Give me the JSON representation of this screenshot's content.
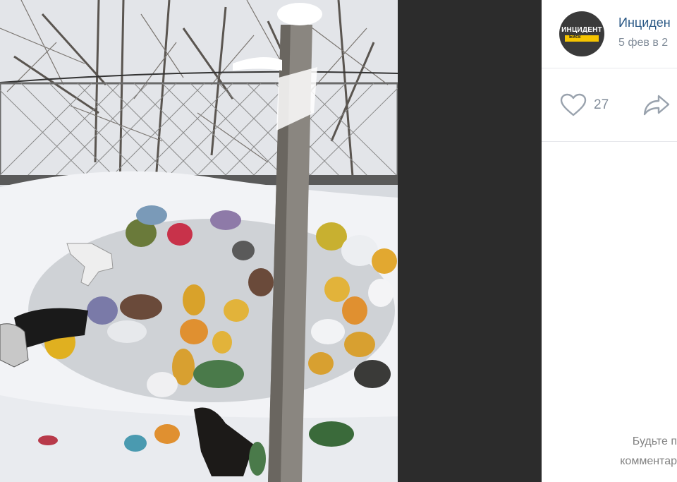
{
  "post": {
    "group_name": "Инциден",
    "date": "5 фев в 2",
    "avatar_text": "ИНЦИДЕНТ",
    "avatar_strip_text": "Ейск",
    "avatar_icon": "group-avatar-logo"
  },
  "actions": {
    "like_icon": "heart-icon",
    "like_count": "27",
    "share_icon": "share-arrow-icon"
  },
  "comments": {
    "hint_line1": "Будьте п",
    "hint_line2": "комментар"
  },
  "photo": {
    "icon": "post-photo"
  },
  "colors": {
    "link": "#2a5885",
    "muted": "#818c99",
    "dark_gap": "#2c2c2c",
    "divider": "#e7e8ec"
  }
}
